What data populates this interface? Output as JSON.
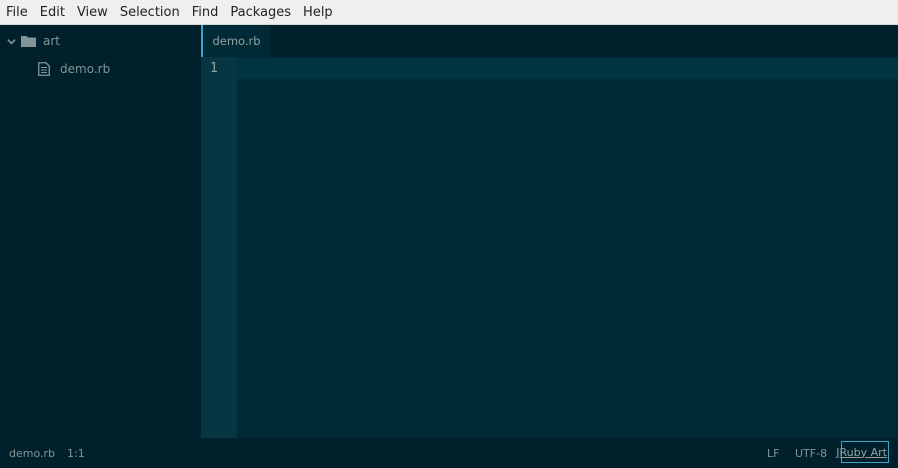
{
  "menubar": {
    "items": [
      "File",
      "Edit",
      "View",
      "Selection",
      "Find",
      "Packages",
      "Help"
    ]
  },
  "treeview": {
    "root": {
      "label": "art",
      "icon": "folder-icon",
      "expanded": true
    },
    "files": [
      {
        "label": "demo.rb",
        "icon": "file-text-icon"
      }
    ]
  },
  "tabs": [
    {
      "label": "demo.rb",
      "active": true
    }
  ],
  "editor": {
    "line_numbers": [
      "1"
    ]
  },
  "statusbar": {
    "file": "demo.rb",
    "cursor": "1:1",
    "eol": "LF",
    "encoding": "UTF-8",
    "grammar": "JRuby Art"
  },
  "colors": {
    "background": "#002b36",
    "sidebar": "#00212b",
    "gutter": "#073642",
    "accent": "#3aa6c9",
    "menubar": "#efefef"
  }
}
